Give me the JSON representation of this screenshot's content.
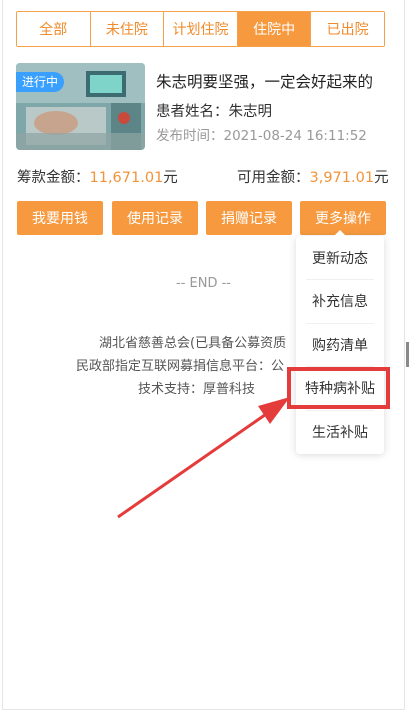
{
  "tabs": [
    {
      "label": "全部"
    },
    {
      "label": "未住院"
    },
    {
      "label": "计划住院"
    },
    {
      "label": "住院中"
    },
    {
      "label": "已出院"
    }
  ],
  "active_tab": "住院中",
  "card": {
    "status_badge": "进行中",
    "title": "朱志明要坚强，一定会好起来的",
    "patient_label": "患者姓名：",
    "patient_name": "朱志明",
    "publish_label": "发布时间：",
    "publish_time": "2021-08-24 16:11:52"
  },
  "amounts": {
    "raised_label": "筹款金额：",
    "raised_value": "11,671.01",
    "raised_unit": "元",
    "available_label": "可用金额：",
    "available_value": "3,971.01",
    "available_unit": "元"
  },
  "actions": {
    "use_money": "我要用钱",
    "usage_records": "使用记录",
    "donation_records": "捐赠记录",
    "more_actions": "更多操作"
  },
  "end_text": "-- END --",
  "footer": {
    "line1": "湖北省慈善总会(已具备公募资质",
    "line2": "民政部指定互联网募捐信息平台：公",
    "line3": "技术支持：厚普科技"
  },
  "menu": {
    "items": [
      {
        "label": "更新动态"
      },
      {
        "label": "补充信息"
      },
      {
        "label": "购药清单"
      },
      {
        "label": "特种病补贴"
      },
      {
        "label": "生活补贴"
      }
    ]
  },
  "colors": {
    "accent": "#f6993f",
    "amount": "#f39339",
    "badge": "#3aa0ff",
    "annotation": "#e43b3b"
  }
}
